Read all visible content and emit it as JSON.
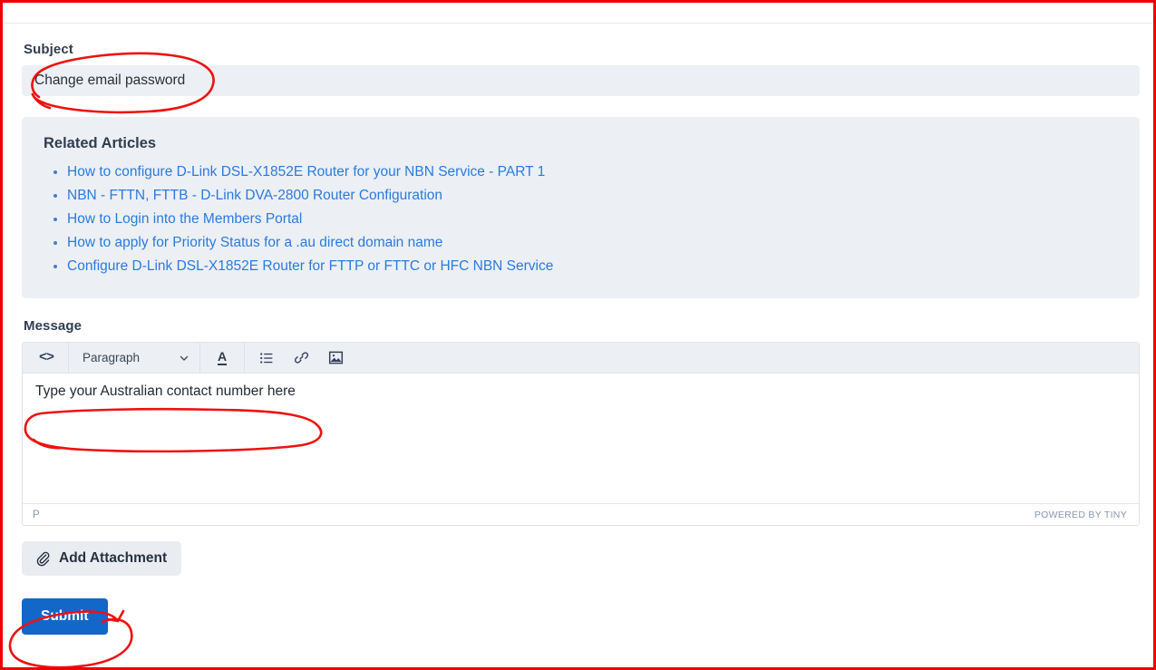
{
  "form": {
    "subject": {
      "label": "Subject",
      "value": "Change email password"
    },
    "related": {
      "title": "Related Articles",
      "links": [
        "How to configure D-Link DSL-X1852E Router for your NBN Service - PART 1",
        "NBN - FTTN, FTTB - D-Link DVA-2800 Router Configuration",
        "How to Login into the Members Portal",
        "How to apply for Priority Status for a .au direct domain name",
        "Configure D-Link DSL-X1852E Router for FTTP or FTTC or HFC NBN Service"
      ]
    },
    "message": {
      "label": "Message",
      "body_text": "Type your Australian contact number here",
      "toolbar": {
        "source_code_label": "<>",
        "format_select_value": "Paragraph",
        "text_color_label": "A"
      },
      "status": {
        "element_path": "P",
        "branding": "POWERED BY TINY"
      }
    },
    "buttons": {
      "attach_label": "Add Attachment",
      "submit_label": "Submit"
    }
  },
  "colors": {
    "panel_bg": "#eceff3",
    "link": "#2a7ae0",
    "submit_bg": "#1267c8",
    "annotation": "#ee1111",
    "frame": "#ee0000"
  }
}
